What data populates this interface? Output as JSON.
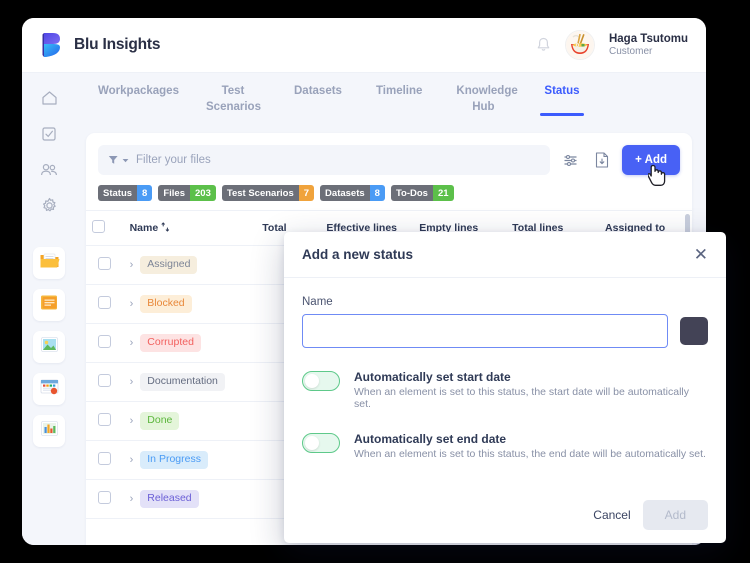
{
  "brand": {
    "name": "Blu Insights",
    "logo_icon": "blu-logo-icon"
  },
  "header": {
    "notification_icon": "bell-icon",
    "avatar_icon": "ramen-bowl-avatar",
    "user_name": "Haga Tsutomu",
    "user_role": "Customer"
  },
  "sidebar": {
    "items": [
      {
        "icon": "home-icon",
        "kind": "outline"
      },
      {
        "icon": "checkbox-task-icon",
        "kind": "outline"
      },
      {
        "icon": "people-icon",
        "kind": "outline"
      },
      {
        "icon": "gear-icon",
        "kind": "outline"
      },
      {
        "icon": "folder-open-icon",
        "kind": "tile"
      },
      {
        "icon": "notes-document-icon",
        "kind": "tile"
      },
      {
        "icon": "image-document-icon",
        "kind": "tile"
      },
      {
        "icon": "calendar-document-icon",
        "kind": "tile"
      },
      {
        "icon": "chart-document-icon",
        "kind": "tile"
      }
    ]
  },
  "tabs": [
    {
      "label": "Workpackages",
      "active": false
    },
    {
      "label": "Test Scenarios",
      "active": false
    },
    {
      "label": "Datasets",
      "active": false
    },
    {
      "label": "Timeline",
      "active": false
    },
    {
      "label": "Knowledge Hub",
      "active": false
    },
    {
      "label": "Status",
      "active": true
    }
  ],
  "toolbar": {
    "filter_placeholder": "Filter your files",
    "filter_value": "",
    "funnel_icon": "filter-funnel-icon",
    "settings_icon": "sliders-settings-icon",
    "export_icon": "document-download-icon",
    "add_label": "+ Add"
  },
  "badges": [
    {
      "label": "Status",
      "value": "8",
      "color": "#4a9bf5"
    },
    {
      "label": "Files",
      "value": "203",
      "color": "#5cc04a"
    },
    {
      "label": "Test Scenarios",
      "value": "7",
      "color": "#f0a33c"
    },
    {
      "label": "Datasets",
      "value": "8",
      "color": "#4a9bf5"
    },
    {
      "label": "To-Dos",
      "value": "21",
      "color": "#5cc04a"
    }
  ],
  "table": {
    "columns": [
      "Name",
      "Total",
      "Effective lines",
      "Empty lines",
      "Total lines",
      "Assigned to"
    ],
    "sort_icon": "sort-arrows-icon",
    "rows": [
      {
        "name": "Assigned",
        "pill_bg": "#f6eede",
        "pill_fg": "#7c8496"
      },
      {
        "name": "Blocked",
        "pill_bg": "#fdeed8",
        "pill_fg": "#e8883a"
      },
      {
        "name": "Corrupted",
        "pill_bg": "#fde3e3",
        "pill_fg": "#f2615f"
      },
      {
        "name": "Documentation",
        "pill_bg": "#f1f2f5",
        "pill_fg": "#646c80"
      },
      {
        "name": "Done",
        "pill_bg": "#e4f5da",
        "pill_fg": "#5bb63c"
      },
      {
        "name": "In Progress",
        "pill_bg": "#d9ecfb",
        "pill_fg": "#4a9bf5"
      },
      {
        "name": "Released",
        "pill_bg": "#e3e1f8",
        "pill_fg": "#6b5fd6"
      }
    ]
  },
  "modal": {
    "title": "Add a new status",
    "close_icon": "close-icon",
    "name_label": "Name",
    "name_value": "",
    "color_swatch": "#434356",
    "toggles": [
      {
        "title": "Automatically set start date",
        "description": "When an element is set to this status, the start date will be automatically set.",
        "on": false
      },
      {
        "title": "Automatically set end date",
        "description": "When an element is set to this status, the end date will be automatically set.",
        "on": false
      }
    ],
    "cancel_label": "Cancel",
    "submit_label": "Add"
  }
}
